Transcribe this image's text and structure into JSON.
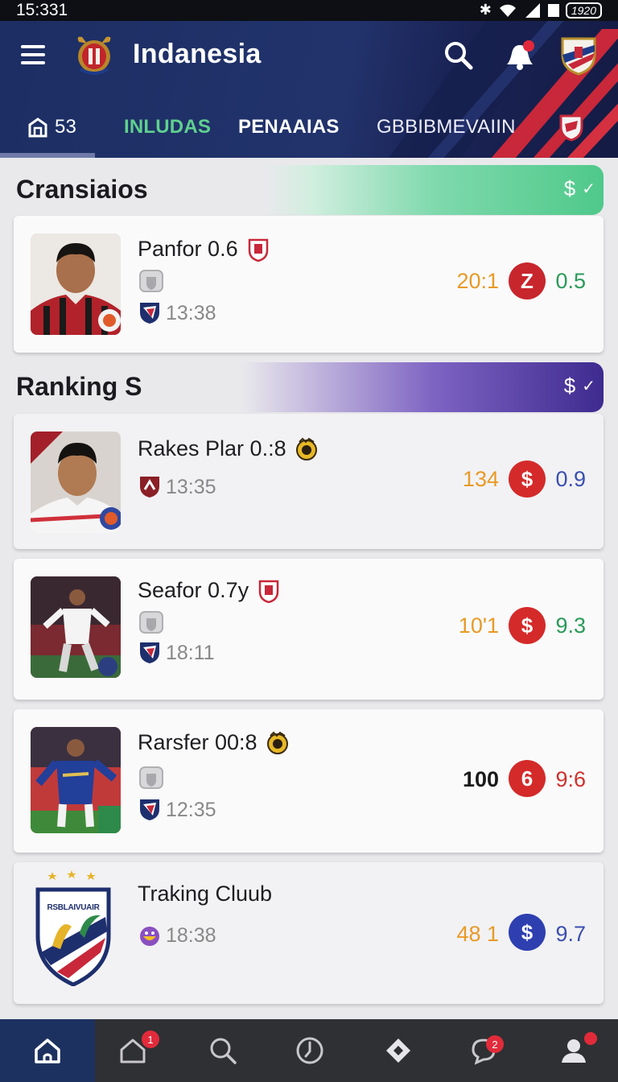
{
  "status_bar": {
    "time": "15:331",
    "battery": "1920"
  },
  "header": {
    "title": "Indanesia",
    "tabs": [
      {
        "label": "53",
        "icon": "stadium-icon"
      },
      {
        "label": "INLUDAS"
      },
      {
        "label": "PENAAIAS"
      },
      {
        "label": "GBBIBMEVAIIN"
      }
    ]
  },
  "sections": [
    {
      "title": "Cransiaios",
      "pill": "$"
    },
    {
      "title": "Ranking S",
      "pill": "$"
    }
  ],
  "cards": [
    {
      "name": "Panfor 0.6",
      "time": "13:38",
      "stat_left": "20:1",
      "stat_badge": "Z",
      "stat_right": "0.5",
      "badge_color": "#c8262d",
      "right_color": "#2a9a5a"
    },
    {
      "name": "Rakes Plar 0.:8",
      "time": "13:35",
      "stat_left": "134",
      "stat_badge": "$",
      "stat_right": "0.9",
      "badge_color": "#d42a2a",
      "right_color": "#3a4fb0"
    },
    {
      "name": "Seafor 0.7y",
      "time": "18:11",
      "stat_left": "10'1",
      "stat_badge": "$",
      "stat_right": "9.3",
      "badge_color": "#d42a2a",
      "right_color": "#2a9a5a"
    },
    {
      "name": "Rarsfer 00:8",
      "time": "12:35",
      "stat_left": "100",
      "stat_badge": "6",
      "stat_right": "9:6",
      "badge_color": "#d42a2a",
      "right_color": "#d0312d"
    },
    {
      "name": "Traking Cluub",
      "time": "18:38",
      "stat_left": "48 1",
      "stat_badge": "$",
      "stat_right": "9.7",
      "badge_color": "#2e3fb0",
      "right_color": "#3a4fb0",
      "crest_text": "RSBLAIVUAIR"
    }
  ],
  "bottom_nav": {
    "items": [
      {
        "icon": "home-icon"
      },
      {
        "icon": "home-outline-icon",
        "badge": "1"
      },
      {
        "icon": "search-icon"
      },
      {
        "icon": "clock-icon"
      },
      {
        "icon": "diamond-icon"
      },
      {
        "icon": "chat-icon",
        "badge": "2"
      },
      {
        "icon": "profile-icon"
      }
    ]
  },
  "colors": {
    "header": "#22336c",
    "accent_green": "#5fd08e",
    "section_green": "#4fd08a",
    "section_purple": "#4a2f9a"
  }
}
